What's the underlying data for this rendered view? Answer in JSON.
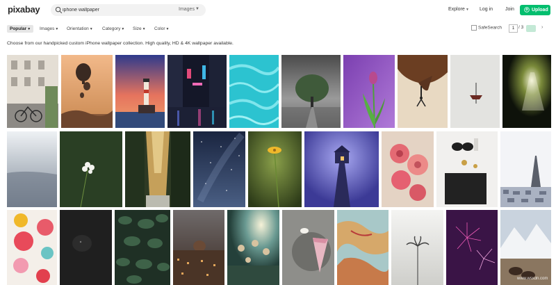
{
  "header": {
    "logo": "pixabay",
    "search_value": "iphone wallpaper",
    "search_type": "Images",
    "explore": "Explore",
    "login": "Log in",
    "join": "Join",
    "upload": "Upload"
  },
  "filters": {
    "popular": "Popular",
    "images": "Images",
    "orientation": "Orientation",
    "category": "Category",
    "size": "Size",
    "color": "Color",
    "safesearch": "SafeSearch",
    "page_current": "1",
    "page_total": "/ 3"
  },
  "description": "Choose from our handpicked custom iPhone wallpaper collection. High quality, HD & 4K wallpaper available.",
  "watermark": "www.wsxdn.com",
  "colors": {
    "accent": "#02be6e",
    "search_bg": "#f2f2f2"
  },
  "photos": [
    {
      "subject": "building-bicycle"
    },
    {
      "subject": "hot-air-balloons"
    },
    {
      "subject": "lighthouse-sunset"
    },
    {
      "subject": "city-night-neon"
    },
    {
      "subject": "turquoise-water"
    },
    {
      "subject": "tree-road"
    },
    {
      "subject": "tulip"
    },
    {
      "subject": "rock-climber"
    },
    {
      "subject": "boat-minimal"
    },
    {
      "subject": "cave-light"
    },
    {
      "subject": "misty-sea"
    },
    {
      "subject": "white-flower"
    },
    {
      "subject": "forest-path"
    },
    {
      "subject": "starry-sky"
    },
    {
      "subject": "yellow-flower"
    },
    {
      "subject": "house-pier"
    },
    {
      "subject": "roses"
    },
    {
      "subject": "flatlay-accessories"
    },
    {
      "subject": "paris-eiffel"
    },
    {
      "subject": "paper-flowers"
    },
    {
      "subject": "dark-dog"
    },
    {
      "subject": "leaves"
    },
    {
      "subject": "florence-city"
    },
    {
      "subject": "flower-field-sunlight"
    },
    {
      "subject": "cake-slice"
    },
    {
      "subject": "world-map"
    },
    {
      "subject": "palm-tree"
    },
    {
      "subject": "fireworks"
    },
    {
      "subject": "mountain-boots"
    }
  ]
}
